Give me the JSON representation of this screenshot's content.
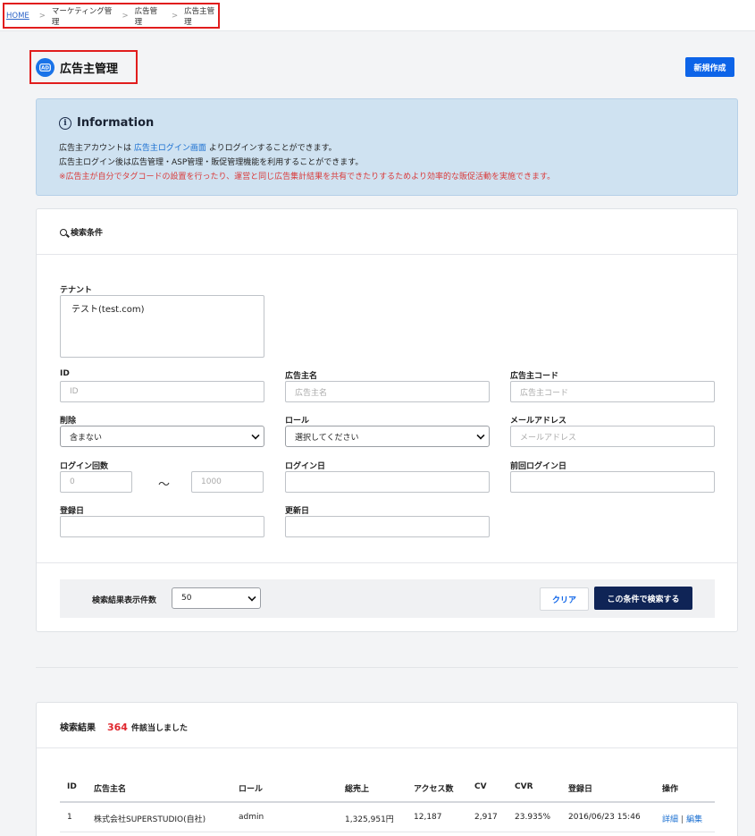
{
  "breadcrumb": {
    "home": "HOME",
    "separator": ">",
    "items": [
      "マーケティング管理",
      "広告管理",
      "広告主管理"
    ]
  },
  "page": {
    "title": "広告主管理",
    "icon": "ad-icon",
    "new_button": "新規作成"
  },
  "info": {
    "title": "Information",
    "line1_prefix": "広告主アカウントは ",
    "line1_link": "広告主ログイン画面",
    "line1_suffix": " よりログインすることができます。",
    "line2": "広告主ログイン後は広告管理・ASP管理・販促管理機能を利用することができます。",
    "line3": "※広告主が自分でタグコードの設置を行ったり、運営と同じ広告集計結果を共有できたりするためより効率的な販促活動を実施できます。"
  },
  "search": {
    "title": "検索条件",
    "tenant_label": "テナント",
    "tenant_value": "テスト(test.com)",
    "id_label": "ID",
    "id_placeholder": "ID",
    "name_label": "広告主名",
    "name_placeholder": "広告主名",
    "code_label": "広告主コード",
    "code_placeholder": "広告主コード",
    "deleted_label": "削除",
    "deleted_value": "含まない",
    "role_label": "ロール",
    "role_value": "選択してください",
    "email_label": "メールアドレス",
    "email_placeholder": "メールアドレス",
    "login_count_label": "ログイン回数",
    "login_min": "0",
    "login_tilde": "〜",
    "login_max": "1000",
    "login_date_label": "ログイン日",
    "last_login_label": "前回ログイン日",
    "created_label": "登録日",
    "updated_label": "更新日",
    "per_page_label": "検索結果表示件数",
    "per_page_value": "50",
    "clear_button": "クリア",
    "submit_button": "この条件で検索する"
  },
  "results": {
    "title": "検索結果",
    "count": "364",
    "count_suffix": "件該当しました",
    "columns": [
      "ID",
      "広告主名",
      "ロール",
      "総売上",
      "アクセス数",
      "CV",
      "CVR",
      "登録日",
      "操作"
    ],
    "rows": [
      {
        "id": "1",
        "name": "株式会社SUPERSTUDIO(自社)",
        "role": "admin",
        "sales": "1,325,951円",
        "access": "12,187",
        "cv": "2,917",
        "cvr": "23.935%",
        "created": "2016/06/23 15:46",
        "detail": "詳細",
        "pipe": "|",
        "edit": "編集"
      }
    ]
  },
  "colors": {
    "primary": "#0d64e8",
    "navy": "#0f2456",
    "highlight": "#e11d1d",
    "info_bg": "#cfe2f1",
    "count_red": "#e0282f"
  }
}
